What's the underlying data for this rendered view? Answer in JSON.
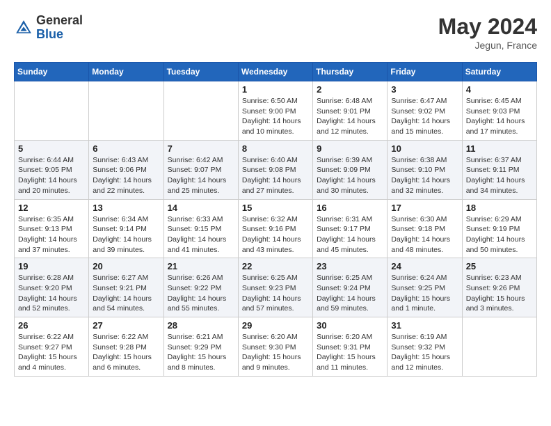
{
  "header": {
    "logo_general": "General",
    "logo_blue": "Blue",
    "month_year": "May 2024",
    "location": "Jegun, France"
  },
  "weekdays": [
    "Sunday",
    "Monday",
    "Tuesday",
    "Wednesday",
    "Thursday",
    "Friday",
    "Saturday"
  ],
  "weeks": [
    [
      {
        "day": "",
        "sunrise": "",
        "sunset": "",
        "daylight": ""
      },
      {
        "day": "",
        "sunrise": "",
        "sunset": "",
        "daylight": ""
      },
      {
        "day": "",
        "sunrise": "",
        "sunset": "",
        "daylight": ""
      },
      {
        "day": "1",
        "sunrise": "Sunrise: 6:50 AM",
        "sunset": "Sunset: 9:00 PM",
        "daylight": "Daylight: 14 hours and 10 minutes."
      },
      {
        "day": "2",
        "sunrise": "Sunrise: 6:48 AM",
        "sunset": "Sunset: 9:01 PM",
        "daylight": "Daylight: 14 hours and 12 minutes."
      },
      {
        "day": "3",
        "sunrise": "Sunrise: 6:47 AM",
        "sunset": "Sunset: 9:02 PM",
        "daylight": "Daylight: 14 hours and 15 minutes."
      },
      {
        "day": "4",
        "sunrise": "Sunrise: 6:45 AM",
        "sunset": "Sunset: 9:03 PM",
        "daylight": "Daylight: 14 hours and 17 minutes."
      }
    ],
    [
      {
        "day": "5",
        "sunrise": "Sunrise: 6:44 AM",
        "sunset": "Sunset: 9:05 PM",
        "daylight": "Daylight: 14 hours and 20 minutes."
      },
      {
        "day": "6",
        "sunrise": "Sunrise: 6:43 AM",
        "sunset": "Sunset: 9:06 PM",
        "daylight": "Daylight: 14 hours and 22 minutes."
      },
      {
        "day": "7",
        "sunrise": "Sunrise: 6:42 AM",
        "sunset": "Sunset: 9:07 PM",
        "daylight": "Daylight: 14 hours and 25 minutes."
      },
      {
        "day": "8",
        "sunrise": "Sunrise: 6:40 AM",
        "sunset": "Sunset: 9:08 PM",
        "daylight": "Daylight: 14 hours and 27 minutes."
      },
      {
        "day": "9",
        "sunrise": "Sunrise: 6:39 AM",
        "sunset": "Sunset: 9:09 PM",
        "daylight": "Daylight: 14 hours and 30 minutes."
      },
      {
        "day": "10",
        "sunrise": "Sunrise: 6:38 AM",
        "sunset": "Sunset: 9:10 PM",
        "daylight": "Daylight: 14 hours and 32 minutes."
      },
      {
        "day": "11",
        "sunrise": "Sunrise: 6:37 AM",
        "sunset": "Sunset: 9:11 PM",
        "daylight": "Daylight: 14 hours and 34 minutes."
      }
    ],
    [
      {
        "day": "12",
        "sunrise": "Sunrise: 6:35 AM",
        "sunset": "Sunset: 9:13 PM",
        "daylight": "Daylight: 14 hours and 37 minutes."
      },
      {
        "day": "13",
        "sunrise": "Sunrise: 6:34 AM",
        "sunset": "Sunset: 9:14 PM",
        "daylight": "Daylight: 14 hours and 39 minutes."
      },
      {
        "day": "14",
        "sunrise": "Sunrise: 6:33 AM",
        "sunset": "Sunset: 9:15 PM",
        "daylight": "Daylight: 14 hours and 41 minutes."
      },
      {
        "day": "15",
        "sunrise": "Sunrise: 6:32 AM",
        "sunset": "Sunset: 9:16 PM",
        "daylight": "Daylight: 14 hours and 43 minutes."
      },
      {
        "day": "16",
        "sunrise": "Sunrise: 6:31 AM",
        "sunset": "Sunset: 9:17 PM",
        "daylight": "Daylight: 14 hours and 45 minutes."
      },
      {
        "day": "17",
        "sunrise": "Sunrise: 6:30 AM",
        "sunset": "Sunset: 9:18 PM",
        "daylight": "Daylight: 14 hours and 48 minutes."
      },
      {
        "day": "18",
        "sunrise": "Sunrise: 6:29 AM",
        "sunset": "Sunset: 9:19 PM",
        "daylight": "Daylight: 14 hours and 50 minutes."
      }
    ],
    [
      {
        "day": "19",
        "sunrise": "Sunrise: 6:28 AM",
        "sunset": "Sunset: 9:20 PM",
        "daylight": "Daylight: 14 hours and 52 minutes."
      },
      {
        "day": "20",
        "sunrise": "Sunrise: 6:27 AM",
        "sunset": "Sunset: 9:21 PM",
        "daylight": "Daylight: 14 hours and 54 minutes."
      },
      {
        "day": "21",
        "sunrise": "Sunrise: 6:26 AM",
        "sunset": "Sunset: 9:22 PM",
        "daylight": "Daylight: 14 hours and 55 minutes."
      },
      {
        "day": "22",
        "sunrise": "Sunrise: 6:25 AM",
        "sunset": "Sunset: 9:23 PM",
        "daylight": "Daylight: 14 hours and 57 minutes."
      },
      {
        "day": "23",
        "sunrise": "Sunrise: 6:25 AM",
        "sunset": "Sunset: 9:24 PM",
        "daylight": "Daylight: 14 hours and 59 minutes."
      },
      {
        "day": "24",
        "sunrise": "Sunrise: 6:24 AM",
        "sunset": "Sunset: 9:25 PM",
        "daylight": "Daylight: 15 hours and 1 minute."
      },
      {
        "day": "25",
        "sunrise": "Sunrise: 6:23 AM",
        "sunset": "Sunset: 9:26 PM",
        "daylight": "Daylight: 15 hours and 3 minutes."
      }
    ],
    [
      {
        "day": "26",
        "sunrise": "Sunrise: 6:22 AM",
        "sunset": "Sunset: 9:27 PM",
        "daylight": "Daylight: 15 hours and 4 minutes."
      },
      {
        "day": "27",
        "sunrise": "Sunrise: 6:22 AM",
        "sunset": "Sunset: 9:28 PM",
        "daylight": "Daylight: 15 hours and 6 minutes."
      },
      {
        "day": "28",
        "sunrise": "Sunrise: 6:21 AM",
        "sunset": "Sunset: 9:29 PM",
        "daylight": "Daylight: 15 hours and 8 minutes."
      },
      {
        "day": "29",
        "sunrise": "Sunrise: 6:20 AM",
        "sunset": "Sunset: 9:30 PM",
        "daylight": "Daylight: 15 hours and 9 minutes."
      },
      {
        "day": "30",
        "sunrise": "Sunrise: 6:20 AM",
        "sunset": "Sunset: 9:31 PM",
        "daylight": "Daylight: 15 hours and 11 minutes."
      },
      {
        "day": "31",
        "sunrise": "Sunrise: 6:19 AM",
        "sunset": "Sunset: 9:32 PM",
        "daylight": "Daylight: 15 hours and 12 minutes."
      },
      {
        "day": "",
        "sunrise": "",
        "sunset": "",
        "daylight": ""
      }
    ]
  ]
}
